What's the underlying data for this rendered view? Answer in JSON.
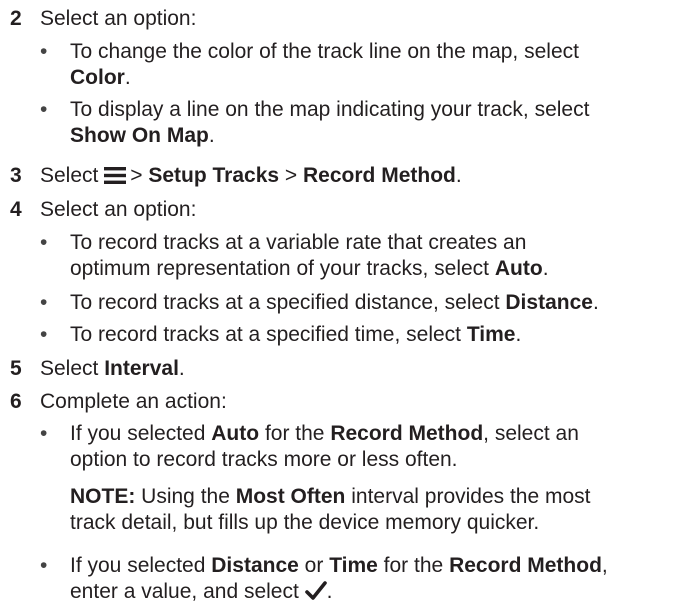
{
  "steps": [
    {
      "num": "2",
      "text": "Select an option:"
    },
    {
      "num": "3",
      "pre": "Select",
      "gt1": ">",
      "b1": "Setup Tracks",
      "gt2": ">",
      "b2": "Record Method",
      "post": "."
    },
    {
      "num": "4",
      "text": "Select an option:"
    },
    {
      "num": "5",
      "pre": "Select",
      "b1": "Interval",
      "post": "."
    },
    {
      "num": "6",
      "text": "Complete an action:"
    }
  ],
  "bullets": {
    "color": {
      "l1": "To change the color of the track line on the map, select",
      "b": "Color",
      "post": "."
    },
    "show": {
      "l1": "To display a line on the map indicating your track, select",
      "b": "Show On Map",
      "post": "."
    },
    "auto": {
      "l1": "To record tracks at a variable rate that creates an",
      "l2": "optimum representation of your tracks, select",
      "b": "Auto",
      "post": "."
    },
    "distance": {
      "pre": "To record tracks at a specified distance, select",
      "b": "Distance",
      "post": "."
    },
    "time": {
      "pre": "To record tracks at a specified time, select",
      "b": "Time",
      "post": "."
    },
    "selected_auto": {
      "pre": "If you selected",
      "b1": "Auto",
      "mid": "for the",
      "b2": "Record Method",
      "post": ", select an",
      "l2": "option to record tracks more or less often."
    },
    "selected_dist": {
      "pre": "If you selected",
      "b1": "Distance",
      "or": "or",
      "b2": "Time",
      "mid": "for the",
      "b3": "Record Method",
      "post": ",",
      "l2pre": "enter a value, and select",
      "l2post": "."
    }
  },
  "note": {
    "label": "NOTE:",
    "pre": "Using the",
    "b": "Most Often",
    "post": "interval provides the most",
    "l2": "track detail, but fills up the device memory quicker."
  },
  "bullet_glyph": "•",
  "icons": {
    "menu": "menu-icon",
    "check": "checkmark-icon"
  },
  "colors": {
    "text": "#231f20"
  }
}
